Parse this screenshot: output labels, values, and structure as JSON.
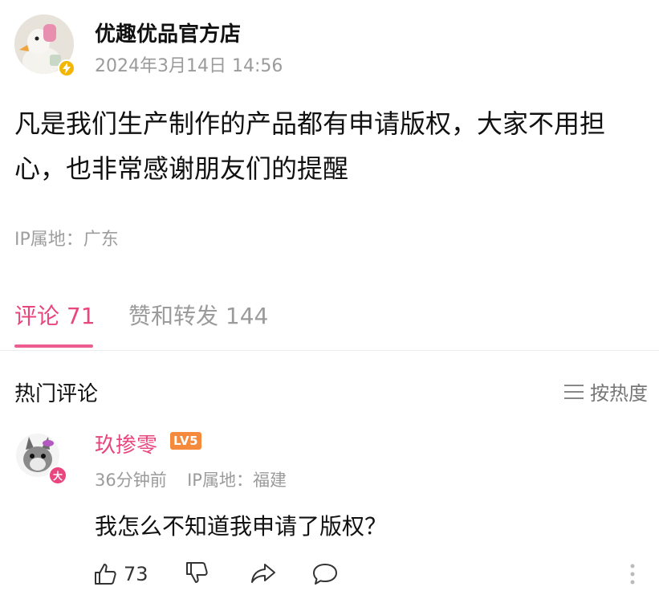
{
  "post": {
    "author": "优趣优品官方店",
    "time": "2024年3月14日 14:56",
    "body": "凡是我们生产制作的产品都有申请版权，大家不用担心，也非常感谢朋友们的提醒",
    "ip_location": "IP属地：广东"
  },
  "tabs": {
    "comments": "评论 71",
    "likes_shares": "赞和转发 144"
  },
  "hot_comments": {
    "title": "热门评论",
    "sort_label": "按热度"
  },
  "comment": {
    "author": "玖掺零",
    "level": "LV5",
    "badge": "大",
    "time": "36分钟前",
    "ip_location": "IP属地：福建",
    "text": "我怎么不知道我申请了版权？",
    "like_count": "73"
  },
  "colors": {
    "accent_pink": "#e9457e",
    "level_orange": "#f58a3c",
    "vip_yellow": "#f2b705"
  },
  "icons": [
    "thumb-up-icon",
    "thumb-down-icon",
    "share-icon",
    "comment-icon",
    "more-icon",
    "sort-lines-icon",
    "lightning-icon"
  ]
}
